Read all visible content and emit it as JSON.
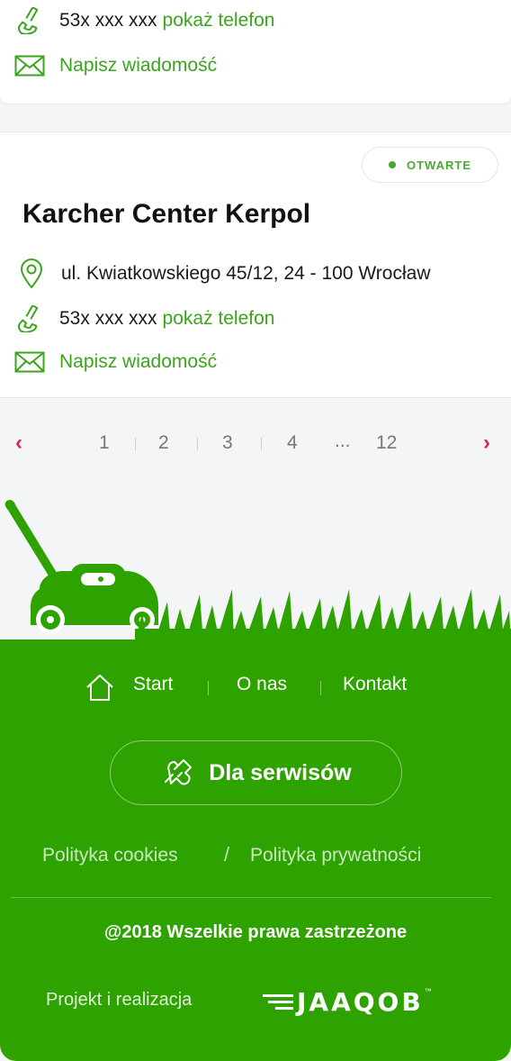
{
  "top_card": {
    "phone_masked": "53x xxx xxx",
    "phone_link": "pokaż telefon",
    "message_link": "Napisz wiadomość"
  },
  "main_card": {
    "status_badge": "OTWARTE",
    "name": "Karcher Center Kerpol",
    "address": "ul. Kwiatkowskiego 45/12, 24 - 100 Wrocław",
    "phone_masked": "53x xxx xxx",
    "phone_link": "pokaż telefon",
    "message_link": "Napisz wiadomość"
  },
  "pagination": {
    "prev": "‹",
    "next": "›",
    "pages": [
      "1",
      "2",
      "3",
      "4",
      "...",
      "12"
    ]
  },
  "footer": {
    "nav": [
      "Start",
      "O nas",
      "Kontakt"
    ],
    "service_button": "Dla serwisów",
    "policy_cookies": "Polityka cookies",
    "policy_sep": "/",
    "policy_privacy": "Polityka prywatności",
    "copyright": "@2018 Wszelkie prawa zastrzeżone",
    "credit": "Projekt i realizacja",
    "logo_text": "JAAQOB",
    "logo_tm": "™"
  },
  "colors": {
    "accent_green": "#3aa51c",
    "footer_bg": "#2ea300",
    "arrow_red": "#d9264a"
  }
}
